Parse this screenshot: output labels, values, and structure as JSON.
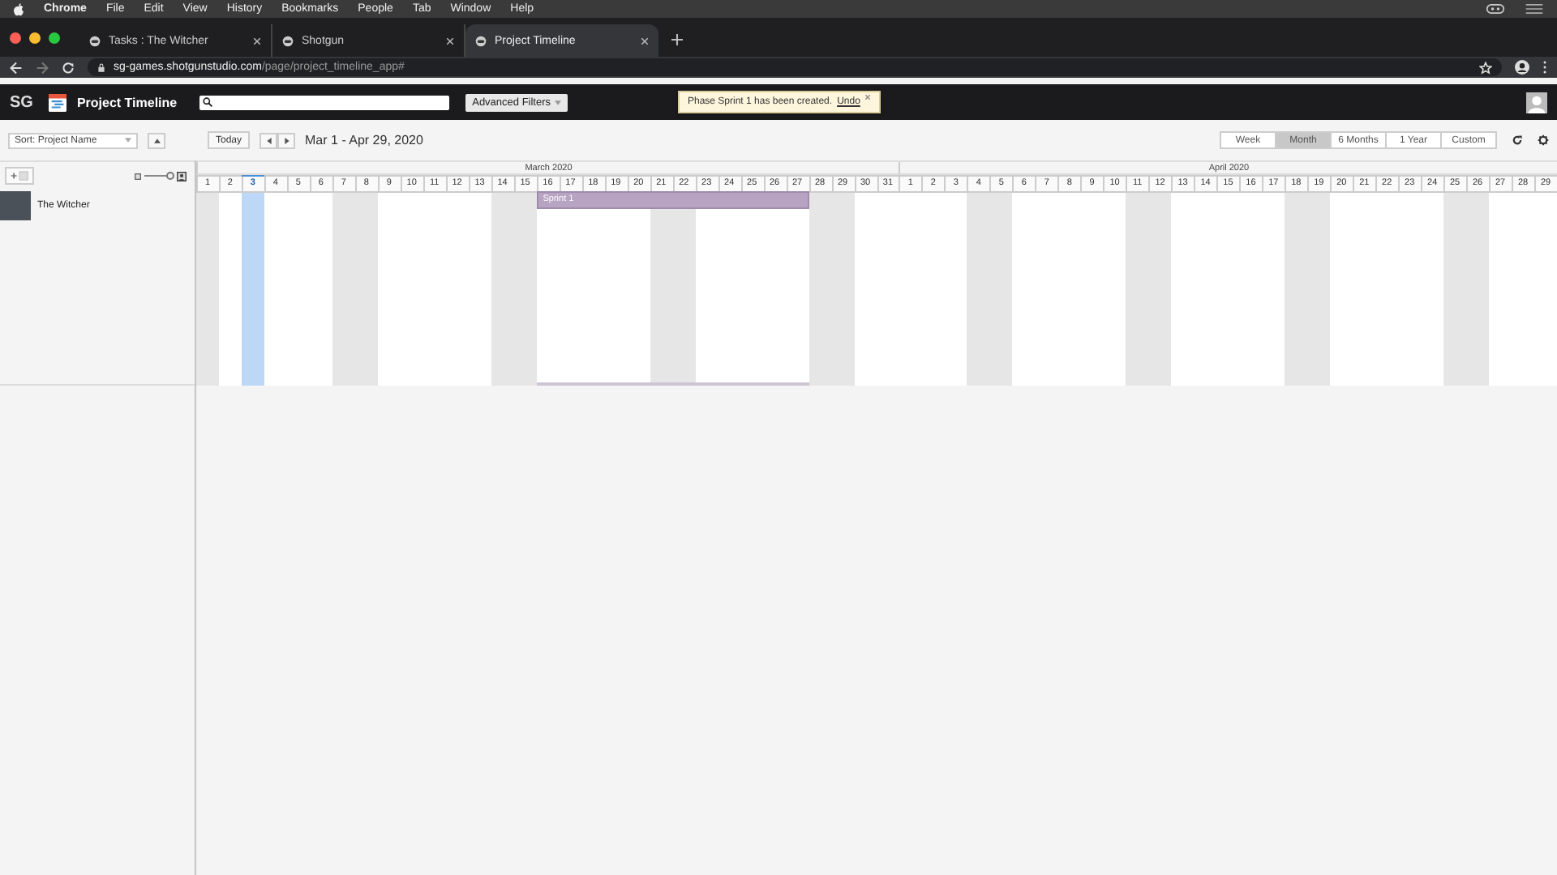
{
  "menubar": {
    "app": "Chrome",
    "items": [
      "File",
      "Edit",
      "View",
      "History",
      "Bookmarks",
      "People",
      "Tab",
      "Window",
      "Help"
    ]
  },
  "browser": {
    "tabs": [
      {
        "title": "Tasks : The Witcher",
        "selected": false
      },
      {
        "title": "Shotgun",
        "selected": false
      },
      {
        "title": "Project Timeline",
        "selected": true
      }
    ],
    "url_host": "sg-games.shotgunstudio.com",
    "url_path": "/page/project_timeline_app#"
  },
  "app": {
    "logo": "SG",
    "title": "Project Timeline",
    "filter_button": "Advanced Filters"
  },
  "toast": {
    "message": "Phase Sprint 1 has been created.",
    "link": "Undo"
  },
  "toolbar": {
    "sort": "Sort: Project Name",
    "today": "Today",
    "range": "Mar 1 - Apr 29, 2020",
    "views": [
      {
        "label": "Week",
        "selected": false
      },
      {
        "label": "Month",
        "selected": true
      },
      {
        "label": "6 Months",
        "selected": false
      },
      {
        "label": "1 Year",
        "selected": false
      },
      {
        "label": "Custom",
        "selected": false
      }
    ]
  },
  "row_height_slider": {
    "level": 0.9
  },
  "projects": [
    {
      "name": "The Witcher",
      "phase": "Sprint 1"
    }
  ],
  "months": [
    {
      "label": "March 2020",
      "days": [
        {
          "label": "1",
          "weekend": true,
          "today": false,
          "in_phase": false
        },
        {
          "label": "2",
          "weekend": false,
          "today": false,
          "in_phase": false
        },
        {
          "label": "3",
          "weekend": false,
          "today": true,
          "in_phase": false
        },
        {
          "label": "4",
          "weekend": false,
          "today": false,
          "in_phase": false
        },
        {
          "label": "5",
          "weekend": false,
          "today": false,
          "in_phase": false
        },
        {
          "label": "6",
          "weekend": false,
          "today": false,
          "in_phase": false
        },
        {
          "label": "7",
          "weekend": true,
          "today": false,
          "in_phase": false
        },
        {
          "label": "8",
          "weekend": true,
          "today": false,
          "in_phase": false
        },
        {
          "label": "9",
          "weekend": false,
          "today": false,
          "in_phase": false
        },
        {
          "label": "10",
          "weekend": false,
          "today": false,
          "in_phase": false
        },
        {
          "label": "11",
          "weekend": false,
          "today": false,
          "in_phase": false
        },
        {
          "label": "12",
          "weekend": false,
          "today": false,
          "in_phase": false
        },
        {
          "label": "13",
          "weekend": false,
          "today": false,
          "in_phase": false
        },
        {
          "label": "14",
          "weekend": true,
          "today": false,
          "in_phase": false
        },
        {
          "label": "15",
          "weekend": true,
          "today": false,
          "in_phase": false
        },
        {
          "label": "16",
          "weekend": false,
          "today": false,
          "in_phase": true
        },
        {
          "label": "17",
          "weekend": false,
          "today": false,
          "in_phase": true
        },
        {
          "label": "18",
          "weekend": false,
          "today": false,
          "in_phase": true
        },
        {
          "label": "19",
          "weekend": false,
          "today": false,
          "in_phase": true
        },
        {
          "label": "20",
          "weekend": false,
          "today": false,
          "in_phase": true
        },
        {
          "label": "21",
          "weekend": true,
          "today": false,
          "in_phase": true
        },
        {
          "label": "22",
          "weekend": true,
          "today": false,
          "in_phase": true
        },
        {
          "label": "23",
          "weekend": false,
          "today": false,
          "in_phase": true
        },
        {
          "label": "24",
          "weekend": false,
          "today": false,
          "in_phase": true
        },
        {
          "label": "25",
          "weekend": false,
          "today": false,
          "in_phase": true
        },
        {
          "label": "26",
          "weekend": false,
          "today": false,
          "in_phase": true
        },
        {
          "label": "27",
          "weekend": false,
          "today": false,
          "in_phase": true
        },
        {
          "label": "28",
          "weekend": true,
          "today": false,
          "in_phase": false
        },
        {
          "label": "29",
          "weekend": true,
          "today": false,
          "in_phase": false
        },
        {
          "label": "30",
          "weekend": false,
          "today": false,
          "in_phase": false
        },
        {
          "label": "31",
          "weekend": false,
          "today": false,
          "in_phase": false
        }
      ]
    },
    {
      "label": "April 2020",
      "days": [
        {
          "label": "1",
          "weekend": false,
          "today": false,
          "in_phase": false
        },
        {
          "label": "2",
          "weekend": false,
          "today": false,
          "in_phase": false
        },
        {
          "label": "3",
          "weekend": false,
          "today": false,
          "in_phase": false
        },
        {
          "label": "4",
          "weekend": true,
          "today": false,
          "in_phase": false
        },
        {
          "label": "5",
          "weekend": true,
          "today": false,
          "in_phase": false
        },
        {
          "label": "6",
          "weekend": false,
          "today": false,
          "in_phase": false
        },
        {
          "label": "7",
          "weekend": false,
          "today": false,
          "in_phase": false
        },
        {
          "label": "8",
          "weekend": false,
          "today": false,
          "in_phase": false
        },
        {
          "label": "9",
          "weekend": false,
          "today": false,
          "in_phase": false
        },
        {
          "label": "10",
          "weekend": false,
          "today": false,
          "in_phase": false
        },
        {
          "label": "11",
          "weekend": true,
          "today": false,
          "in_phase": false
        },
        {
          "label": "12",
          "weekend": true,
          "today": false,
          "in_phase": false
        },
        {
          "label": "13",
          "weekend": false,
          "today": false,
          "in_phase": false
        },
        {
          "label": "14",
          "weekend": false,
          "today": false,
          "in_phase": false
        },
        {
          "label": "15",
          "weekend": false,
          "today": false,
          "in_phase": false
        },
        {
          "label": "16",
          "weekend": false,
          "today": false,
          "in_phase": false
        },
        {
          "label": "17",
          "weekend": false,
          "today": false,
          "in_phase": false
        },
        {
          "label": "18",
          "weekend": true,
          "today": false,
          "in_phase": false
        },
        {
          "label": "19",
          "weekend": true,
          "today": false,
          "in_phase": false
        },
        {
          "label": "20",
          "weekend": false,
          "today": false,
          "in_phase": false
        },
        {
          "label": "21",
          "weekend": false,
          "today": false,
          "in_phase": false
        },
        {
          "label": "22",
          "weekend": false,
          "today": false,
          "in_phase": false
        },
        {
          "label": "23",
          "weekend": false,
          "today": false,
          "in_phase": false
        },
        {
          "label": "24",
          "weekend": false,
          "today": false,
          "in_phase": false
        },
        {
          "label": "25",
          "weekend": true,
          "today": false,
          "in_phase": false
        },
        {
          "label": "26",
          "weekend": true,
          "today": false,
          "in_phase": false
        },
        {
          "label": "27",
          "weekend": false,
          "today": false,
          "in_phase": false
        },
        {
          "label": "28",
          "weekend": false,
          "today": false,
          "in_phase": false
        },
        {
          "label": "29",
          "weekend": false,
          "today": false,
          "in_phase": false
        }
      ]
    }
  ]
}
